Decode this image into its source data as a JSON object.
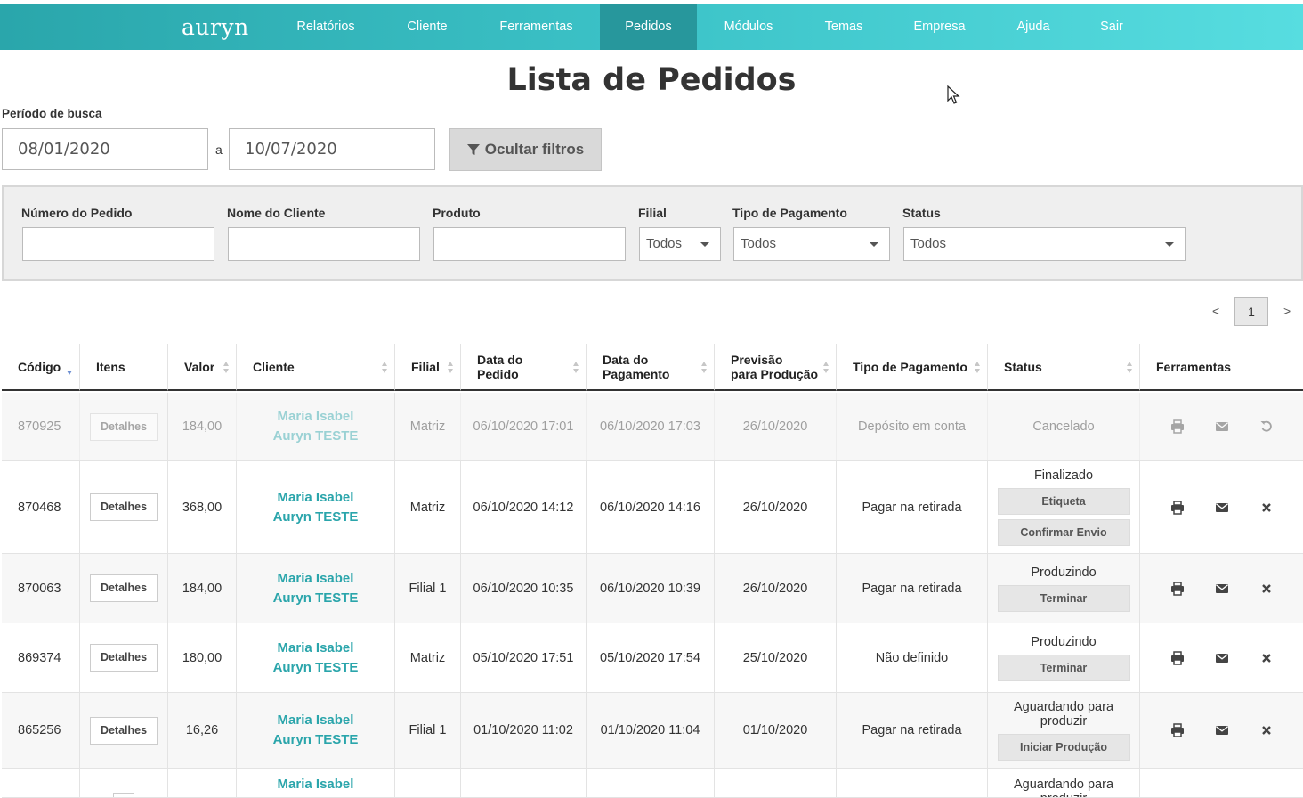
{
  "nav": {
    "brand": "auryn",
    "items": [
      "Relatórios",
      "Cliente",
      "Ferramentas",
      "Pedidos",
      "Módulos",
      "Temas",
      "Empresa",
      "Ajuda",
      "Sair"
    ],
    "active": "Pedidos",
    "colors": {
      "bar_start": "#2aa6ab",
      "bar_end": "#57dde0",
      "active": "#27979c"
    }
  },
  "page": {
    "title": "Lista de Pedidos"
  },
  "search": {
    "period_label": "Período de busca",
    "date_from": "08/01/2020",
    "separator": "a",
    "date_to": "10/07/2020",
    "toggle_filters_label": "Ocultar filtros"
  },
  "filters": {
    "order_number_label": "Número do Pedido",
    "client_name_label": "Nome do Cliente",
    "product_label": "Produto",
    "branch_label": "Filial",
    "branch_value": "Todos",
    "payment_type_label": "Tipo de Pagamento",
    "payment_type_value": "Todos",
    "status_label": "Status",
    "status_value": "Todos"
  },
  "pager": {
    "prev": "<",
    "page": "1",
    "next": ">"
  },
  "table": {
    "headers": {
      "code": "Código",
      "items": "Itens",
      "value": "Valor",
      "client": "Cliente",
      "branch": "Filial",
      "order_date_1": "Data do",
      "order_date_2": "Pedido",
      "payment_date_1": "Data do",
      "payment_date_2": "Pagamento",
      "forecast_1": "Previsão",
      "forecast_2": "para Produção",
      "payment_type": "Tipo de Pagamento",
      "status": "Status",
      "tools": "Ferramentas"
    },
    "details_label": "Detalhes",
    "rows": [
      {
        "code": "870925",
        "value": "184,00",
        "client_1": "Maria Isabel",
        "client_2": "Auryn TESTE",
        "branch": "Matriz",
        "order_date": "06/10/2020 17:01",
        "payment_date": "06/10/2020 17:03",
        "forecast": "26/10/2020",
        "payment_type": "Depósito em conta",
        "status": "Cancelado"
      },
      {
        "code": "870468",
        "value": "368,00",
        "client_1": "Maria Isabel",
        "client_2": "Auryn TESTE",
        "branch": "Matriz",
        "order_date": "06/10/2020 14:12",
        "payment_date": "06/10/2020 14:16",
        "forecast": "26/10/2020",
        "payment_type": "Pagar na retirada",
        "status": "Finalizado",
        "action_1": "Etiqueta",
        "action_2": "Confirmar Envio"
      },
      {
        "code": "870063",
        "value": "184,00",
        "client_1": "Maria Isabel",
        "client_2": "Auryn TESTE",
        "branch": "Filial 1",
        "order_date": "06/10/2020 10:35",
        "payment_date": "06/10/2020 10:39",
        "forecast": "26/10/2020",
        "payment_type": "Pagar na retirada",
        "status": "Produzindo",
        "action_1": "Terminar"
      },
      {
        "code": "869374",
        "value": "180,00",
        "client_1": "Maria Isabel",
        "client_2": "Auryn TESTE",
        "branch": "Matriz",
        "order_date": "05/10/2020 17:51",
        "payment_date": "05/10/2020 17:54",
        "forecast": "25/10/2020",
        "payment_type": "Não definido",
        "status": "Produzindo",
        "action_1": "Terminar"
      },
      {
        "code": "865256",
        "value": "16,26",
        "client_1": "Maria Isabel",
        "client_2": "Auryn TESTE",
        "branch": "Filial 1",
        "order_date": "01/10/2020 11:02",
        "payment_date": "01/10/2020 11:04",
        "forecast": "01/10/2020",
        "payment_type": "Pagar na retirada",
        "status_1": "Aguardando para",
        "status_2": "produzir",
        "action_1": "Iniciar Produção"
      },
      {
        "client_1": "Maria Isabel",
        "status_1": "Aguardando para",
        "status_2": "produzir"
      }
    ]
  }
}
